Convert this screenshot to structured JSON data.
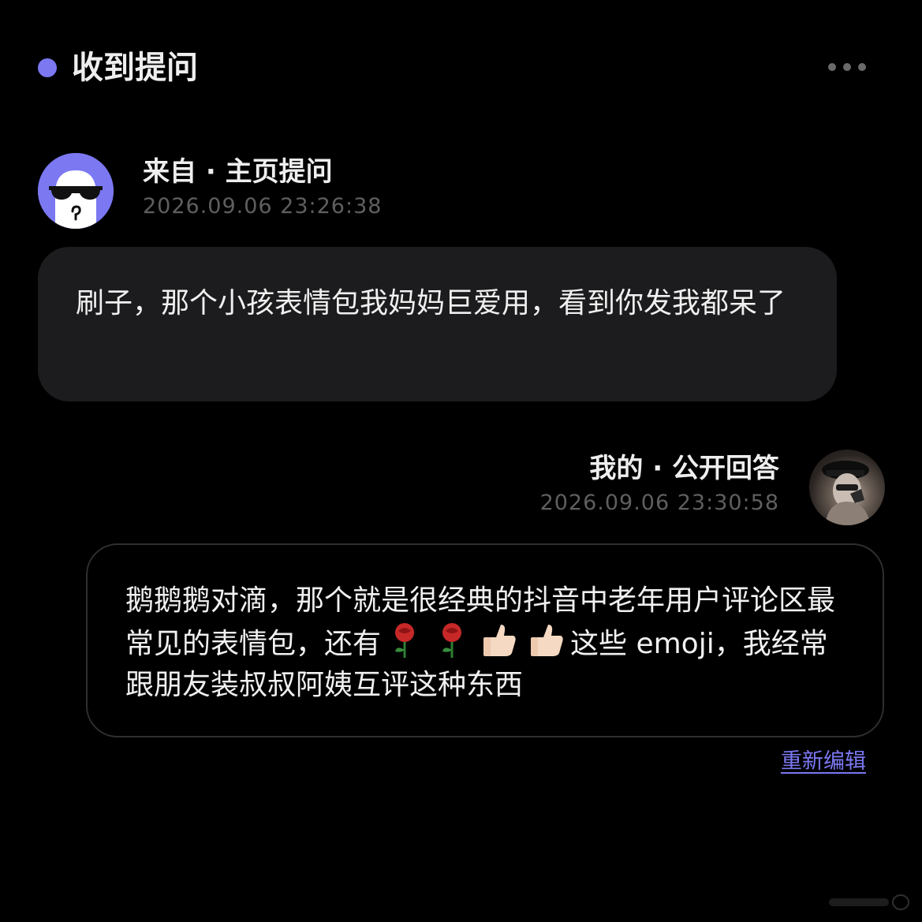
{
  "header": {
    "title": "收到提问",
    "accent_color": "#7b78f2",
    "more_icon": "more-dots-icon"
  },
  "question": {
    "avatar_icon": "sunglasses-ghost-avatar",
    "source": "来自 · 主页提问",
    "time": "2026.09.06 23:26:38",
    "text": "刷子，那个小孩表情包我妈妈巨爱用，看到你发我都呆了"
  },
  "answer": {
    "source": "我的 · 公开回答",
    "time": "2026.09.06 23:30:58",
    "avatar_icon": "user-photo-avatar",
    "text_part1": "鹅鹅鹅对滴，那个就是很经典的抖音中老年用户评论区最常见的表情包，还有",
    "emojis": [
      "rose-emoji",
      "rose-emoji",
      "thumbs-up-emoji",
      "thumbs-up-emoji"
    ],
    "text_part2": "这些 emoji，我经常跟朋友装叔叔阿姨互评这种东西",
    "edit_label": "重新编辑"
  }
}
